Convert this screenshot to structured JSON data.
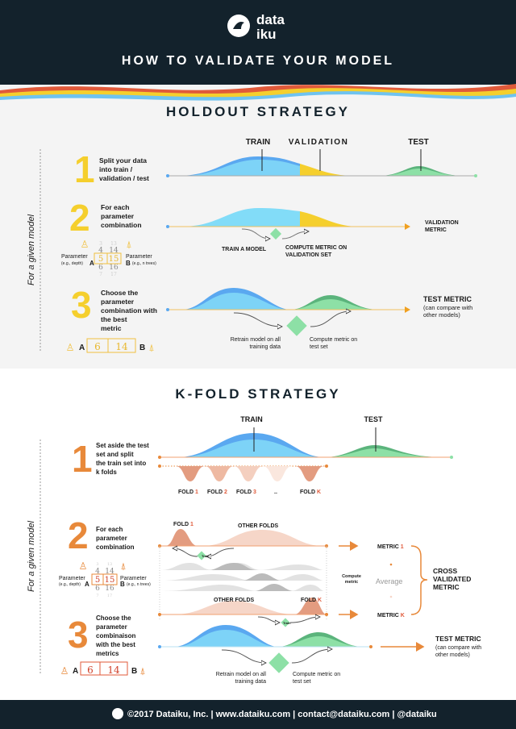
{
  "header": {
    "logo_line1": "data",
    "logo_line2": "iku",
    "title": "HOW TO VALIDATE YOUR MODEL"
  },
  "side_label": "For a given model",
  "holdout": {
    "title": "HOLDOUT STRATEGY",
    "accent": "#f5cf2d",
    "labels": {
      "train": "TRAIN",
      "validation": "VALIDATION",
      "test": "TEST"
    },
    "steps": [
      {
        "number": "1",
        "lines": [
          "Split your data",
          "into train /",
          "validation / test"
        ]
      },
      {
        "number": "2",
        "lines": [
          "For each",
          "parameter",
          "combination"
        ]
      },
      {
        "number": "3",
        "lines": [
          "Choose the",
          "parameter",
          "combination with",
          "the best",
          "metric"
        ]
      }
    ],
    "train_model": "TRAIN A MODEL",
    "compute_metric": [
      "COMPUTE METRIC ON",
      "VALIDATION SET"
    ],
    "validation_metric": [
      "VALIDATION",
      "METRIC"
    ],
    "retrain": [
      "Retrain model on all",
      "training data"
    ],
    "compute_test": [
      "Compute metric on",
      "test set"
    ],
    "test_metric": "TEST METRIC",
    "test_metric_note": [
      "(can compare with",
      "other models)"
    ],
    "param_a": {
      "label": "Parameter",
      "example": "(e.g., depth)",
      "letter": "A",
      "values": [
        "3",
        "4",
        "5",
        "6",
        "7"
      ]
    },
    "param_b": {
      "label": "Parameter",
      "example": "(e.g., n trees)",
      "letter": "B",
      "values": [
        "13",
        "14",
        "15",
        "16",
        "17"
      ]
    },
    "best": {
      "a": "6",
      "b": "14",
      "a_letter": "A",
      "b_letter": "B"
    }
  },
  "kfold": {
    "title": "K-FOLD STRATEGY",
    "accent": "#e8893a",
    "labels": {
      "train": "TRAIN",
      "test": "TEST"
    },
    "steps": [
      {
        "number": "1",
        "lines": [
          "Set aside the test",
          "set and split",
          "the train set into",
          "k folds"
        ]
      },
      {
        "number": "2",
        "lines": [
          "For each",
          "parameter",
          "combination"
        ]
      },
      {
        "number": "3",
        "lines": [
          "Choose the",
          "parameter",
          "combinaison",
          "with the best",
          "metrics"
        ]
      }
    ],
    "folds": [
      {
        "word": "FOLD",
        "id": "1"
      },
      {
        "word": "FOLD",
        "id": "2"
      },
      {
        "word": "FOLD",
        "id": "3"
      },
      {
        "word": "",
        "id": ".."
      },
      {
        "word": "FOLD",
        "id": "K"
      }
    ],
    "fold1": {
      "word": "FOLD",
      "id": "1"
    },
    "foldk": {
      "word": "FOLD",
      "id": "K"
    },
    "other_folds": "OTHER FOLDS",
    "train_tag": "Train",
    "compute_metric": [
      "Compute",
      "metric"
    ],
    "metric1": {
      "word": "METRIC",
      "id": "1"
    },
    "metrick": {
      "word": "METRIC",
      "id": "K"
    },
    "average": "Average",
    "cross": [
      "CROSS",
      "VALIDATED",
      "METRIC"
    ],
    "retrain": [
      "Retrain model on all",
      "training data"
    ],
    "compute_test": [
      "Compute metric on",
      "test set"
    ],
    "test_metric": "TEST METRIC",
    "test_metric_note": [
      "(can compare with",
      "other models)"
    ],
    "param_a": {
      "label": "Parameter",
      "example": "(e.g., depth)",
      "letter": "A",
      "values": [
        "3",
        "4",
        "5",
        "6",
        "7"
      ]
    },
    "param_b": {
      "label": "Parameter",
      "example": "(e.g., n trees)",
      "letter": "B",
      "values": [
        "13",
        "14",
        "15",
        "16",
        "17"
      ]
    },
    "best": {
      "a": "6",
      "b": "14",
      "a_letter": "A",
      "b_letter": "B"
    }
  },
  "footer": {
    "text": "©2017 Dataiku, Inc. | www.dataiku.com | contact@dataiku.com | @dataiku"
  },
  "colors": {
    "navy": "#13222c",
    "train": "#7dd3f7",
    "train_dark": "#5aa8f0",
    "validation": "#f5cf2d",
    "test": "#8de0a6",
    "test_dark": "#5bb47c",
    "fold": "#e8a88a"
  }
}
